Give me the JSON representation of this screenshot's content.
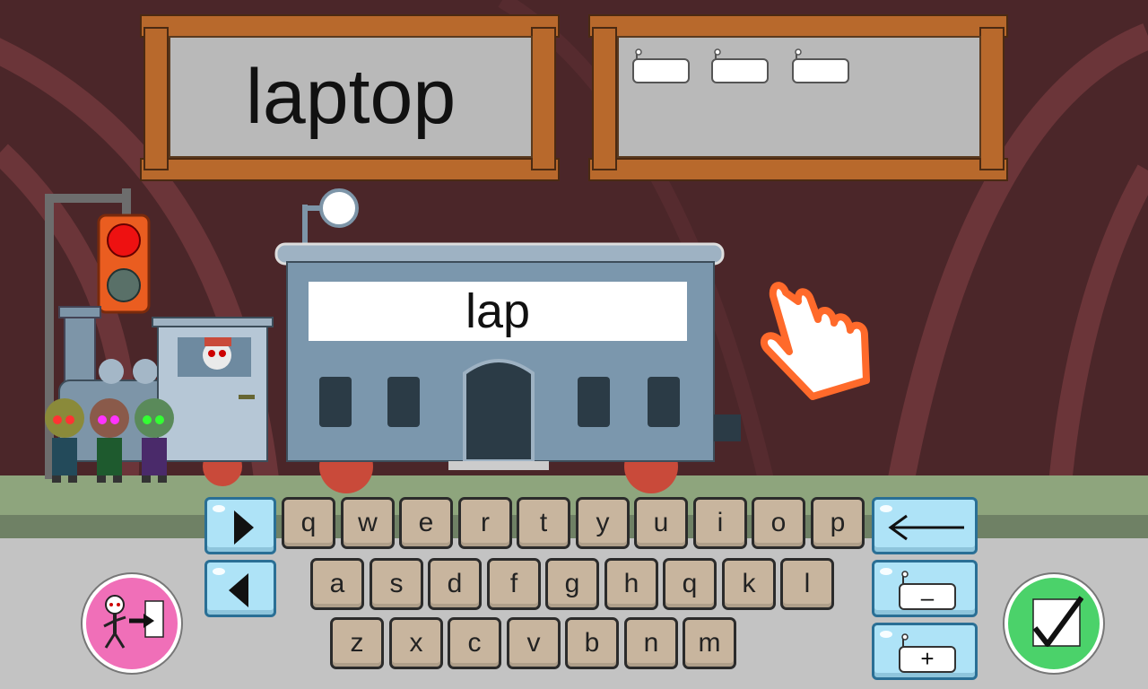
{
  "game": {
    "target_word": "laptop",
    "typed_word": "lap",
    "wagons_remaining": 3
  },
  "keyboard": {
    "row1": [
      "q",
      "w",
      "e",
      "r",
      "t",
      "y",
      "u",
      "i",
      "o",
      "p"
    ],
    "row2": [
      "a",
      "s",
      "d",
      "f",
      "g",
      "h",
      "q",
      "k",
      "l"
    ],
    "row3": [
      "z",
      "x",
      "c",
      "v",
      "b",
      "n",
      "m"
    ]
  },
  "controls": {
    "minus_label": "–",
    "plus_label": "+"
  },
  "colors": {
    "accent_orange": "#ff6a2b",
    "exit_button": "#f06fb8",
    "confirm_button": "#4bd26a",
    "key_color": "#c8b59e",
    "control_blue": "#aee3f7"
  },
  "icons": {
    "forward": "play-right-icon",
    "back": "play-left-icon",
    "backspace": "arrow-left-icon",
    "wagon": "train-wagon-icon",
    "exit": "exit-skeleton-icon",
    "confirm": "checkmark-icon"
  }
}
